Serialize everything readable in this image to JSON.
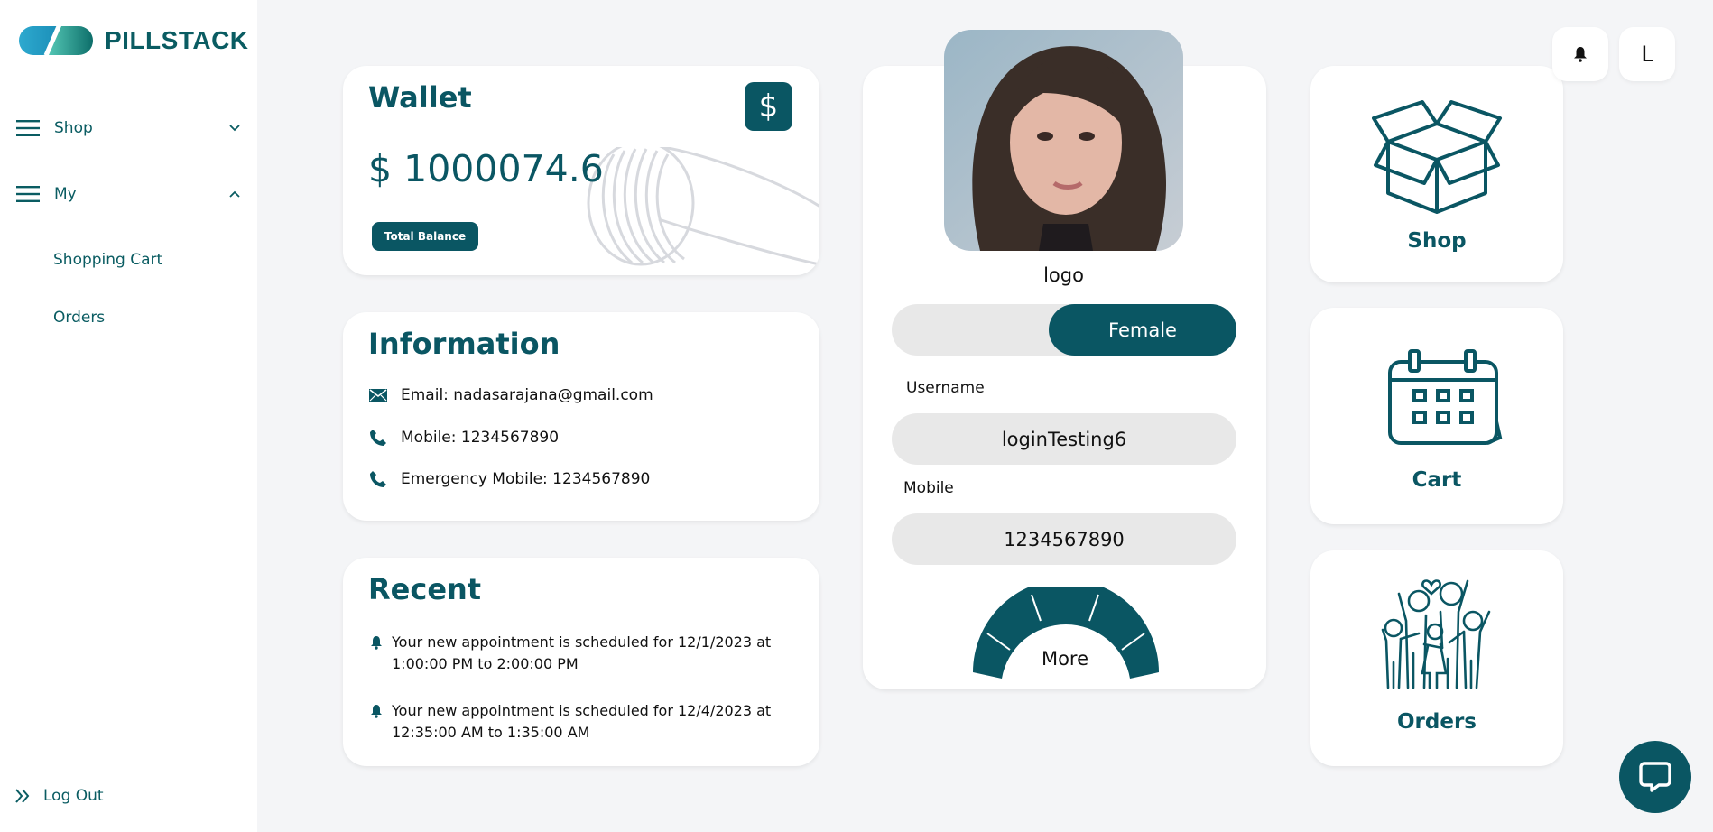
{
  "brand": {
    "name": "PILLSTACK"
  },
  "sidebar": {
    "items": [
      {
        "label": "Shop",
        "expanded": false
      },
      {
        "label": "My",
        "expanded": true
      }
    ],
    "subitems": [
      {
        "label": "Shopping Cart"
      },
      {
        "label": "Orders"
      }
    ],
    "logout_label": "Log Out"
  },
  "wallet": {
    "title": "Wallet",
    "currency_symbol": "$",
    "balance": "$ 1000074.6",
    "badge": "Total Balance"
  },
  "information": {
    "title": "Information",
    "email": "Email: nadasarajana@gmail.com",
    "mobile": "Mobile: 1234567890",
    "emergency": "Emergency Mobile: 1234567890"
  },
  "recent": {
    "title": "Recent",
    "items": [
      {
        "text": "Your new appointment is scheduled for 12/1/2023 at 1:00:00 PM to 2:00:00 PM"
      },
      {
        "text": "Your new appointment is scheduled for 12/4/2023 at 12:35:00 AM to 1:35:00 AM"
      }
    ]
  },
  "profile": {
    "logo_caption": "logo",
    "gender": "Female",
    "username_label": "Username",
    "username": "loginTesting6",
    "mobile_label": "Mobile",
    "mobile": "1234567890",
    "more_label": "More"
  },
  "tiles": [
    {
      "label": "Shop"
    },
    {
      "label": "Cart"
    },
    {
      "label": "Orders"
    }
  ],
  "header": {
    "avatar_letter": "L"
  },
  "colors": {
    "accent": "#0a5663",
    "background": "#f4f5f7",
    "field": "#e8e8e8"
  }
}
